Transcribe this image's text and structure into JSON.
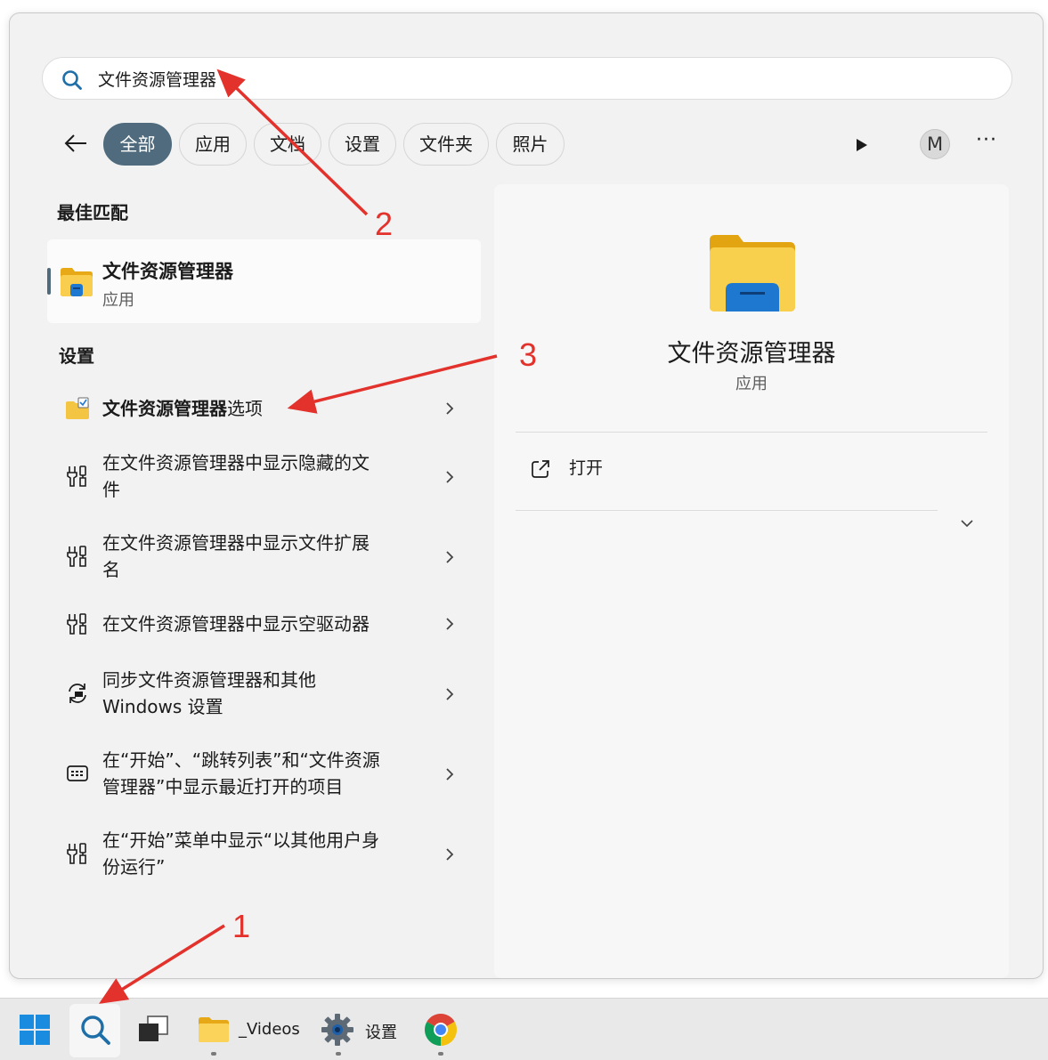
{
  "search": {
    "query": "文件资源管理器"
  },
  "filters": [
    {
      "label": "全部",
      "active": true
    },
    {
      "label": "应用"
    },
    {
      "label": "文档"
    },
    {
      "label": "设置"
    },
    {
      "label": "文件夹"
    },
    {
      "label": "照片"
    }
  ],
  "account_initial": "M",
  "more_label": "···",
  "best_match": {
    "heading": "最佳匹配",
    "name": "文件资源管理器",
    "kind": "应用"
  },
  "settings_section": {
    "heading": "设置",
    "items": [
      {
        "bold": "文件资源管理器",
        "rest": "选项",
        "icon": "folder-options-icon"
      },
      {
        "line1": "在文件资源管理器中显示隐藏的文",
        "line2": "件",
        "icon": "settings-tools-icon"
      },
      {
        "line1": "在文件资源管理器中显示文件扩展",
        "line2": "名",
        "icon": "settings-tools-icon"
      },
      {
        "line1": "在文件资源管理器中显示空驱动器",
        "icon": "settings-tools-icon"
      },
      {
        "line1": "同步文件资源管理器和其他",
        "line2": "Windows 设置",
        "icon": "sync-icon"
      },
      {
        "line1": "在“开始”、“跳转列表”和“文件资源",
        "line2": "管理器”中显示最近打开的项目",
        "icon": "recent-items-icon"
      },
      {
        "line1": "在“开始”菜单中显示“以其他用户身",
        "line2": "份运行”",
        "icon": "settings-tools-icon"
      }
    ]
  },
  "preview": {
    "title": "文件资源管理器",
    "kind": "应用",
    "open_label": "打开"
  },
  "taskbar": {
    "videos_label": "_Videos",
    "settings_label": "设置"
  },
  "annotations": {
    "one": "1",
    "two": "2",
    "three": "3"
  },
  "colors": {
    "accent": "#4f6b7d",
    "annotation": "#e3312b",
    "folder": "#f7c948",
    "folder_blue": "#1e78d0"
  }
}
